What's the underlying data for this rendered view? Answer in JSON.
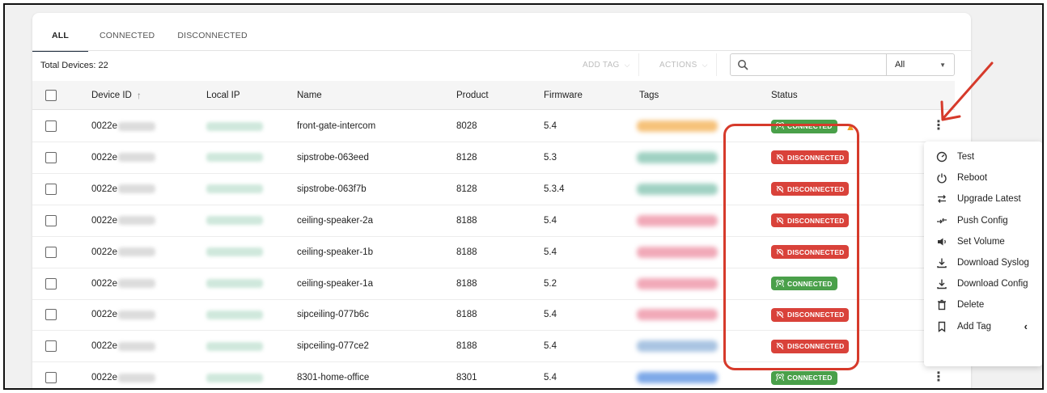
{
  "tabs": [
    {
      "label": "ALL",
      "active": true
    },
    {
      "label": "CONNECTED",
      "active": false
    },
    {
      "label": "DISCONNECTED",
      "active": false
    }
  ],
  "toolbar": {
    "total_label": "Total Devices: 22",
    "add_tag_label": "ADD TAG",
    "actions_label": "ACTIONS",
    "search_placeholder": "",
    "filter_value": "All"
  },
  "columns": {
    "device_id": "Device ID",
    "local_ip": "Local IP",
    "name": "Name",
    "product": "Product",
    "firmware": "Firmware",
    "tags": "Tags",
    "status": "Status"
  },
  "status_labels": {
    "connected": "CONNECTED",
    "disconnected": "DISCONNECTED"
  },
  "colors": {
    "accent_tab": "#1c2a3a",
    "connected": "#4aa04a",
    "disconnected": "#d9423a",
    "annotation": "#d63a2b",
    "warning": "#f0a020"
  },
  "rows": [
    {
      "device_id": "0022e",
      "name": "front-gate-intercom",
      "product": "8028",
      "firmware": "5.4",
      "status": "connected",
      "tag_color": "#f6c27a",
      "warning": true,
      "menu_open": true
    },
    {
      "device_id": "0022e",
      "name": "sipstrobe-063eed",
      "product": "8128",
      "firmware": "5.3",
      "status": "disconnected",
      "tag_color": "#9fd1c2"
    },
    {
      "device_id": "0022e",
      "name": "sipstrobe-063f7b",
      "product": "8128",
      "firmware": "5.3.4",
      "status": "disconnected",
      "tag_color": "#9fd1c2"
    },
    {
      "device_id": "0022e",
      "name": "ceiling-speaker-2a",
      "product": "8188",
      "firmware": "5.4",
      "status": "disconnected",
      "tag_color": "#f1a9b8"
    },
    {
      "device_id": "0022e",
      "name": "ceiling-speaker-1b",
      "product": "8188",
      "firmware": "5.4",
      "status": "disconnected",
      "tag_color": "#f1a9b8"
    },
    {
      "device_id": "0022e",
      "name": "ceiling-speaker-1a",
      "product": "8188",
      "firmware": "5.2",
      "status": "connected",
      "tag_color": "#f1a9b8"
    },
    {
      "device_id": "0022e",
      "name": "sipceiling-077b6c",
      "product": "8188",
      "firmware": "5.4",
      "status": "disconnected",
      "tag_color": "#f1a9b8"
    },
    {
      "device_id": "0022e",
      "name": "sipceiling-077ce2",
      "product": "8188",
      "firmware": "5.4",
      "status": "disconnected",
      "tag_color": "#a9c4e2"
    },
    {
      "device_id": "0022e",
      "name": "8301-home-office",
      "product": "8301",
      "firmware": "5.4",
      "status": "connected",
      "tag_color": "#7ea9e8",
      "kebab": true
    }
  ],
  "context_menu": [
    {
      "label": "Test",
      "icon": "gauge-icon"
    },
    {
      "label": "Reboot",
      "icon": "power-icon"
    },
    {
      "label": "Upgrade Latest",
      "icon": "swap-arrows-icon"
    },
    {
      "label": "Push Config",
      "icon": "push-arrows-icon"
    },
    {
      "label": "Set Volume",
      "icon": "speaker-icon"
    },
    {
      "label": "Download Syslog",
      "icon": "download-icon"
    },
    {
      "label": "Download Config",
      "icon": "download-icon"
    },
    {
      "label": "Delete",
      "icon": "trash-icon"
    },
    {
      "label": "Add Tag",
      "icon": "bookmark-icon",
      "submenu": true
    }
  ]
}
